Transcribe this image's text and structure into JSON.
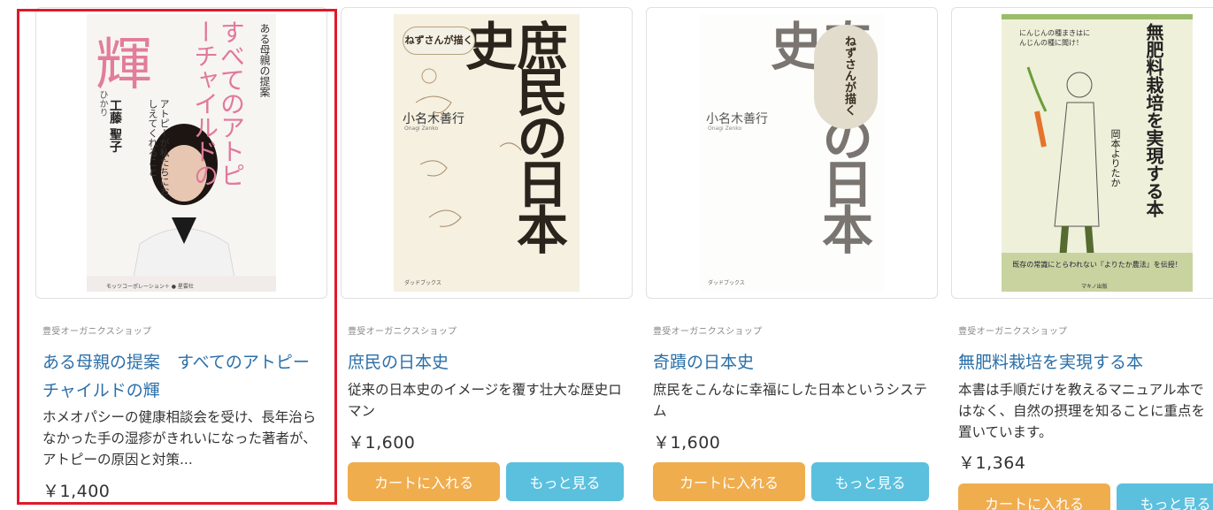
{
  "products": [
    {
      "shop": "豊受オーガニクスショップ",
      "title": "ある母親の提案　すべてのアトピーチャイルドの輝",
      "description": "ホメオパシーの健康相談会を受け、長年治らなかった手の湿疹がきれいになった著者が、アトピーの原因と対策...",
      "price": "￥1,400",
      "cover": {
        "series": "ある母親の提案",
        "big": "すべてのアトピーチャイルドの",
        "kanji": "輝",
        "ruby": "ひかり",
        "subtitle": "アトピーが私たちにおしえてくれること",
        "author": "工藤 聖子",
        "publisher": "モッツコーポレーション＋ ● 星雲社"
      }
    },
    {
      "shop": "豊受オーガニクスショップ",
      "title": "庶民の日本史",
      "description": "従来の日本史のイメージを覆す壮大な歴史ロマン",
      "price": "￥1,600",
      "cart_label": "カートに入れる",
      "more_label": "もっと見る",
      "cover": {
        "big": "庶民の日本史",
        "badge": "ねずさんが描く",
        "author": "小名木善行",
        "author_en": "Onagi Zenko",
        "publisher": "ダッドブックス"
      }
    },
    {
      "shop": "豊受オーガニクスショップ",
      "title": "奇蹟の日本史",
      "description": "庶民をこんなに幸福にした日本というシステム",
      "price": "￥1,600",
      "cart_label": "カートに入れる",
      "more_label": "もっと見る",
      "cover": {
        "big": "奇蹟の日本史",
        "badge": "ねずさんが描く",
        "author": "小名木善行",
        "author_en": "Onagi Zenko",
        "publisher": "ダッドブックス"
      }
    },
    {
      "shop": "豊受オーガニクスショップ",
      "title": "無肥料栽培を実現する本",
      "description": "本書は手順だけを教えるマニュアル本ではなく、自然の摂理を知ることに重点を置いています。",
      "price": "￥1,364",
      "cart_label": "カートに入れる",
      "more_label": "もっと見る",
      "cover": {
        "big": "無肥料栽培を実現する本",
        "top_note": "にんじんの種まきはにんじんの種に聞け！",
        "author": "岡本よりたか",
        "tagline": "既存の常識にとらわれない『よりたか農法』を伝授！",
        "publisher": "マキノ出版"
      }
    }
  ],
  "colors": {
    "link": "#2a6fa8",
    "cart_button": "#f0ad4e",
    "more_button": "#5bc0de",
    "selected_outline": "#e0192a"
  }
}
